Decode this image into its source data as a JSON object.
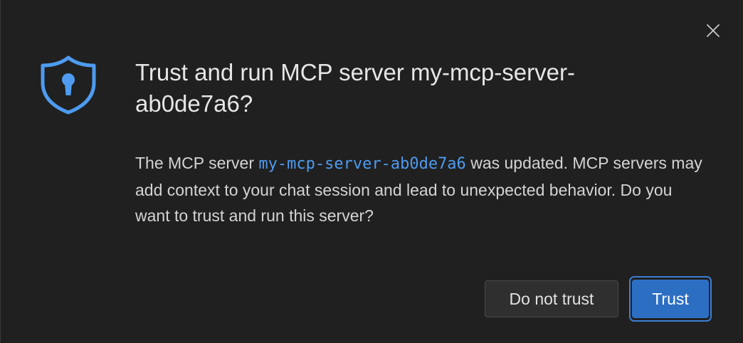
{
  "dialog": {
    "title": "Trust and run MCP server my-mcp-server-ab0de7a6?",
    "message_prefix": "The MCP server ",
    "server_name": "my-mcp-server-ab0de7a6",
    "message_suffix": " was updated. MCP servers may add context to your chat session and lead to unexpected behavior. Do you want to trust and run this server?",
    "icon": "shield-lock-icon",
    "close_icon": "close-icon"
  },
  "buttons": {
    "do_not_trust_label": "Do not trust",
    "trust_label": "Trust"
  },
  "colors": {
    "background": "#202020",
    "accent": "#4e9bf0",
    "primary_button": "#2c6ec2",
    "secondary_button": "#2f2f2f"
  }
}
